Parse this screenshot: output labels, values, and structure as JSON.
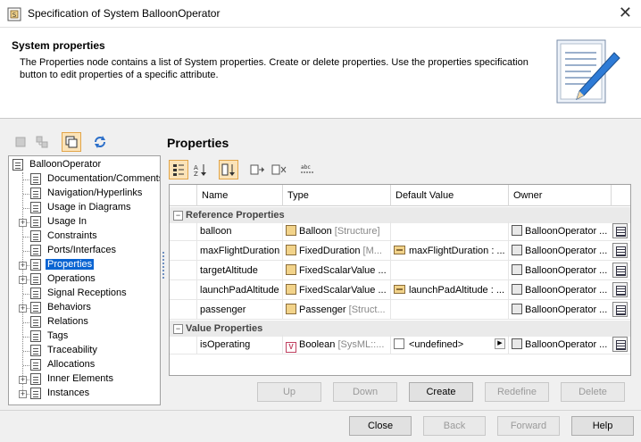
{
  "window": {
    "title": "Specification of System BalloonOperator",
    "close_glyph": "✕"
  },
  "header": {
    "title": "System properties",
    "description": "The Properties node contains a list of System properties. Create or delete properties. Use the properties specification button to edit properties of a specific attribute."
  },
  "tree": {
    "root": "BalloonOperator",
    "items": [
      {
        "label": "Documentation/Comments",
        "expandable": false
      },
      {
        "label": "Navigation/Hyperlinks",
        "expandable": false
      },
      {
        "label": "Usage in Diagrams",
        "expandable": false
      },
      {
        "label": "Usage In",
        "expandable": true
      },
      {
        "label": "Constraints",
        "expandable": false
      },
      {
        "label": "Ports/Interfaces",
        "expandable": false
      },
      {
        "label": "Properties",
        "expandable": true,
        "selected": true
      },
      {
        "label": "Operations",
        "expandable": true
      },
      {
        "label": "Signal Receptions",
        "expandable": false
      },
      {
        "label": "Behaviors",
        "expandable": true
      },
      {
        "label": "Relations",
        "expandable": false
      },
      {
        "label": "Tags",
        "expandable": false
      },
      {
        "label": "Traceability",
        "expandable": false
      },
      {
        "label": "Allocations",
        "expandable": false
      },
      {
        "label": "Inner Elements",
        "expandable": true
      },
      {
        "label": "Instances",
        "expandable": true
      }
    ]
  },
  "panel": {
    "title": "Properties"
  },
  "grid": {
    "columns": [
      "Name",
      "Type",
      "Default Value",
      "Owner"
    ],
    "groups": [
      {
        "label": "Reference Properties",
        "rows": [
          {
            "name": "balloon",
            "type": "Balloon",
            "type_extra": "[Structure]",
            "default": "",
            "owner": "BalloonOperator ..."
          },
          {
            "name": "maxFlightDuration",
            "type": "FixedDuration",
            "type_extra": "[M...",
            "default": "maxFlightDuration : ...",
            "owner": "BalloonOperator ..."
          },
          {
            "name": "targetAltitude",
            "type": "FixedScalarValue ...",
            "type_extra": "",
            "default": "",
            "owner": "BalloonOperator ..."
          },
          {
            "name": "launchPadAltitude",
            "type": "FixedScalarValue ...",
            "type_extra": "",
            "default": "launchPadAltitude : ...",
            "owner": "BalloonOperator ..."
          },
          {
            "name": "passenger",
            "type": "Passenger",
            "type_extra": "[Struct...",
            "default": "",
            "owner": "BalloonOperator ..."
          }
        ]
      },
      {
        "label": "Value Properties",
        "rows": [
          {
            "name": "isOperating",
            "type": "Boolean",
            "type_extra": "[SysML::...",
            "default": "<undefined>",
            "owner": "BalloonOperator ..."
          }
        ]
      }
    ]
  },
  "grid_buttons": {
    "up": "Up",
    "down": "Down",
    "create": "Create",
    "redefine": "Redefine",
    "delete": "Delete"
  },
  "footer_buttons": {
    "close": "Close",
    "back": "Back",
    "forward": "Forward",
    "help": "Help"
  },
  "colors": {
    "selection": "#0a64d2",
    "active_tool": "#fbe3b8",
    "group_bg": "#eaeaea"
  }
}
